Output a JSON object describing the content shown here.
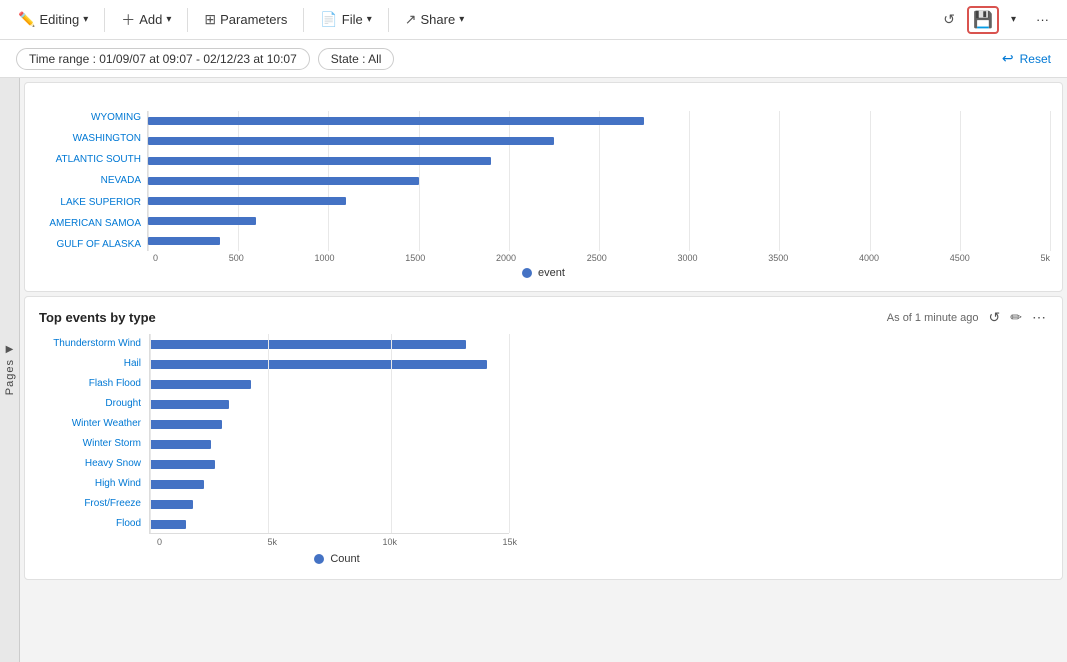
{
  "toolbar": {
    "editing_label": "Editing",
    "add_label": "Add",
    "parameters_label": "Parameters",
    "file_label": "File",
    "share_label": "Share",
    "reset_label": "Reset"
  },
  "filter_bar": {
    "time_range_label": "Time range : 01/09/07 at 09:07 - 02/12/23 at 10:07",
    "state_label": "State : All",
    "reset_label": "Reset"
  },
  "pages_sidebar": {
    "arrow_label": "▶",
    "label": "Pages"
  },
  "top_chart": {
    "y_labels": [
      "WYOMING",
      "WASHINGTON",
      "ATLANTIC SOUTH",
      "NEVADA",
      "LAKE SUPERIOR",
      "AMERICAN SAMOA",
      "GULF OF ALASKA"
    ],
    "x_ticks": [
      "0",
      "500",
      "1000",
      "1500",
      "2000",
      "2500",
      "3000",
      "3500",
      "4000",
      "4500",
      "5k"
    ],
    "legend": "event",
    "bars": [
      0.55,
      0.45,
      0.38,
      0.3,
      0.22,
      0.12,
      0.08
    ]
  },
  "bottom_chart": {
    "title": "Top events by type",
    "subtitle": "As of 1 minute ago",
    "y_labels": [
      "Thunderstorm Wind",
      "Hail",
      "Flash Flood",
      "Drought",
      "Winter Weather",
      "Winter Storm",
      "Heavy Snow",
      "High Wind",
      "Frost/Freeze",
      "Flood"
    ],
    "x_ticks": [
      "0",
      "5k",
      "10k",
      "15k"
    ],
    "legend": "Count",
    "bars": [
      0.88,
      0.94,
      0.28,
      0.22,
      0.2,
      0.17,
      0.18,
      0.15,
      0.12,
      0.1
    ]
  }
}
